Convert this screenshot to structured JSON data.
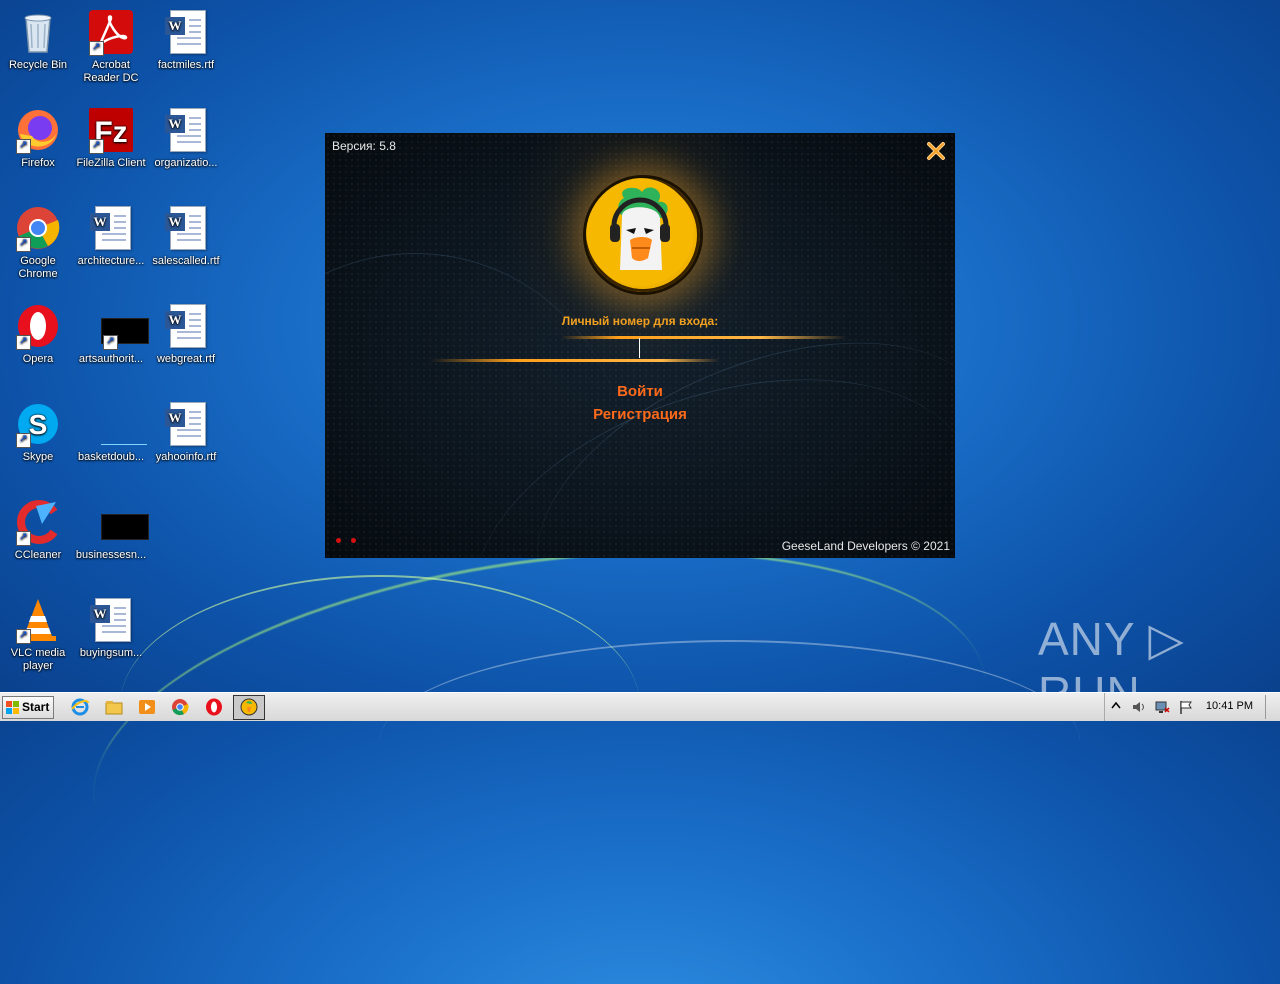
{
  "desktop": {
    "icons": [
      {
        "label": "Recycle Bin",
        "icon": "recycle-bin-icon"
      },
      {
        "label": "Acrobat Reader DC",
        "icon": "acrobat-icon"
      },
      {
        "label": "factmiles.rtf",
        "icon": "word-doc-icon"
      },
      {
        "label": "Firefox",
        "icon": "firefox-icon"
      },
      {
        "label": "FileZilla Client",
        "icon": "filezilla-icon"
      },
      {
        "label": "organizatio...",
        "icon": "word-doc-icon"
      },
      {
        "label": "Google Chrome",
        "icon": "chrome-icon"
      },
      {
        "label": "architecture...",
        "icon": "word-doc-icon"
      },
      {
        "label": "salescalled.rtf",
        "icon": "word-doc-icon"
      },
      {
        "label": "Opera",
        "icon": "opera-icon"
      },
      {
        "label": "artsauthorit...",
        "icon": "black-file-icon"
      },
      {
        "label": "webgreat.rtf",
        "icon": "word-doc-icon"
      },
      {
        "label": "Skype",
        "icon": "skype-icon"
      },
      {
        "label": "basketdoub...",
        "icon": "blank-file-icon"
      },
      {
        "label": "yahooinfo.rtf",
        "icon": "word-doc-icon"
      },
      {
        "label": "CCleaner",
        "icon": "ccleaner-icon"
      },
      {
        "label": "businessesn...",
        "icon": "black-file-icon"
      },
      {
        "label": "VLC media player",
        "icon": "vlc-icon"
      },
      {
        "label": "buyingsum...",
        "icon": "word-doc-icon"
      }
    ]
  },
  "dialog": {
    "version": "Версия: 5.8",
    "login_label": "Личный номер для входа:",
    "login_value": "",
    "login_button": "Войти",
    "register_link": "Регистрация",
    "copyright": "GeeseLand Developers © 2021",
    "accent_color": "#ff6a1a"
  },
  "watermark": "ANY ▷ RUN",
  "taskbar": {
    "start_label": "Start",
    "pinned": [
      "internet-explorer-icon",
      "explorer-icon",
      "media-player-icon",
      "chrome-icon",
      "opera-icon",
      "geeseland-icon"
    ],
    "clock": "10:41 PM"
  }
}
